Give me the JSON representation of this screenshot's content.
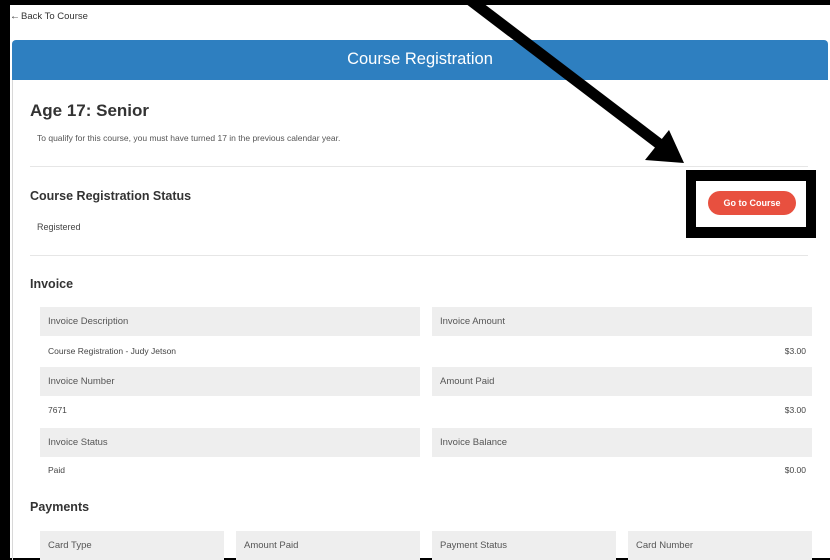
{
  "nav": {
    "back_label": "Back To Course"
  },
  "header": {
    "title": "Course Registration"
  },
  "course": {
    "title": "Age 17: Senior",
    "qualification": "To qualify for this course, you must have turned 17 in the previous calendar year."
  },
  "registration": {
    "section_title": "Course Registration Status",
    "status": "Registered",
    "go_button": "Go to Course"
  },
  "invoice": {
    "section_title": "Invoice",
    "fields": [
      {
        "label": "Invoice Description",
        "value": "Course Registration - Judy Jetson"
      },
      {
        "label": "Invoice Amount",
        "value": "$3.00"
      },
      {
        "label": "Invoice Number",
        "value": "7671"
      },
      {
        "label": "Amount Paid",
        "value": "$3.00"
      },
      {
        "label": "Invoice Status",
        "value": "Paid"
      },
      {
        "label": "Invoice Balance",
        "value": "$0.00"
      }
    ]
  },
  "payments": {
    "section_title": "Payments",
    "columns": [
      "Card Type",
      "Amount Paid",
      "Payment Status",
      "Card Number"
    ]
  },
  "colors": {
    "header": "#2e7fc0",
    "go_button": "#e8503f",
    "label_bg": "#eeeeee"
  },
  "icons": {
    "back": "arrow-left-icon",
    "annotation": "pointer-arrow-icon"
  }
}
